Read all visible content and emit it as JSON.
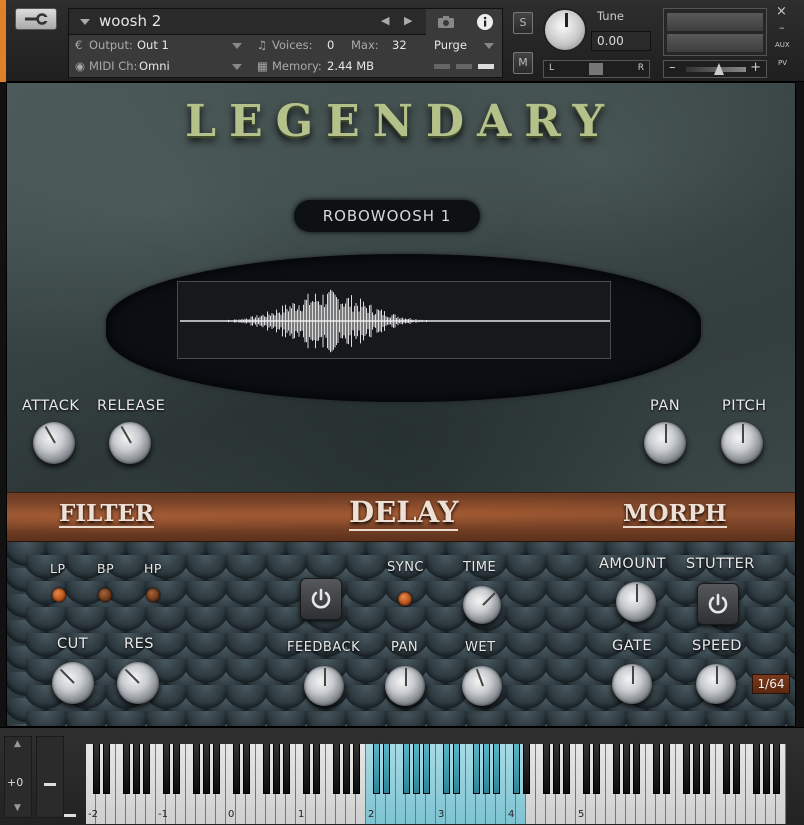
{
  "header": {
    "instrument_name": "woosh 2",
    "output_label": "Output:",
    "output_value": "Out 1",
    "voices_label": "Voices:",
    "voices_value": "0",
    "max_label": "Max:",
    "max_value": "32",
    "midi_label": "MIDI Ch:",
    "midi_value": "Omni",
    "memory_label": "Memory:",
    "memory_value": "2.44 MB",
    "purge_label": "Purge",
    "solo_label": "S",
    "mute_label": "M",
    "tune_label": "Tune",
    "tune_value": "0.00",
    "pan_left": "L",
    "pan_right": "R",
    "vol_minus": "–",
    "vol_plus": "+",
    "close_label": "×",
    "min_label": "–",
    "aux_label": "AUX",
    "pv_label": "PV"
  },
  "instrument": {
    "title": "LEGENDARY",
    "preset_name": "ROBOWOOSH 1",
    "top_knobs": {
      "attack": "ATTACK",
      "release": "RELEASE",
      "pan": "PAN",
      "pitch": "PITCH"
    },
    "sections": {
      "filter": "FILTER",
      "delay": "DELAY",
      "morph": "MORPH"
    },
    "filter": {
      "lp": "LP",
      "bp": "BP",
      "hp": "HP",
      "cut": "CUT",
      "res": "RES",
      "active_mode": "LP"
    },
    "delay": {
      "sync": "SYNC",
      "time": "TIME",
      "feedback": "FEEDBACK",
      "pan": "PAN",
      "wet": "WET"
    },
    "morph": {
      "amount": "AMOUNT",
      "stutter": "STUTTER",
      "gate": "GATE",
      "speed": "SPEED",
      "rate": "1/64"
    }
  },
  "keyboard": {
    "octave_shift": "+0",
    "octave_labels": [
      "-2",
      "-1",
      "0",
      "1",
      "2",
      "3",
      "4",
      "5"
    ]
  },
  "colors": {
    "accent_orange": "#e0802a",
    "title_green": "#b5c18a",
    "key_highlight": "#7ec3d1"
  }
}
